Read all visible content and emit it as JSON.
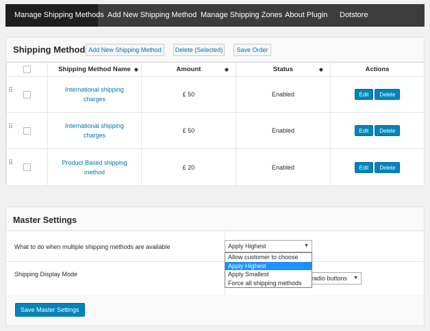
{
  "tabs": [
    {
      "label": "Manage Shipping Methods",
      "active": true
    },
    {
      "label": "Add New Shipping Method",
      "active": false
    },
    {
      "label": "Manage Shipping Zones",
      "active": false
    },
    {
      "label": "About Plugin",
      "active": false
    },
    {
      "label": "Dotstore",
      "active": false
    }
  ],
  "shipping_methods": {
    "title": "Shipping Methods",
    "add_button": "Add New Shipping Method",
    "delete_selected_button": "Delete (Selected)",
    "save_order_button": "Save Order",
    "columns": {
      "name": "Shipping Method Name",
      "amount": "Amount",
      "status": "Status",
      "actions": "Actions"
    },
    "rows": [
      {
        "name": "International shipping charges",
        "amount": "£ 50",
        "status": "Enabled",
        "edit": "Edit",
        "delete": "Delete"
      },
      {
        "name": "International shipping charges",
        "amount": "£ 50",
        "status": "Enabled",
        "edit": "Edit",
        "delete": "Delete"
      },
      {
        "name": "Product Based shipping method",
        "amount": "£ 20",
        "status": "Enabled",
        "edit": "Edit",
        "delete": "Delete"
      }
    ]
  },
  "master_settings": {
    "title": "Master Settings",
    "multiple_methods_label": "What to do when multiple shipping methods are available",
    "multiple_methods_value": "Apply Highest",
    "multiple_methods_options": [
      "Allow customer to choose",
      "Apply Highest",
      "Apply Smallest",
      "Force all shipping methods"
    ],
    "display_mode_label": "Shipping Display Mode",
    "display_mode_value_visible": "radio buttons",
    "save_button": "Save Master Settings"
  },
  "colors": {
    "accent": "#0085ba",
    "link": "#0073aa",
    "tabbar": "#3c3c3c",
    "dropdown_highlight": "#1e90ff"
  }
}
